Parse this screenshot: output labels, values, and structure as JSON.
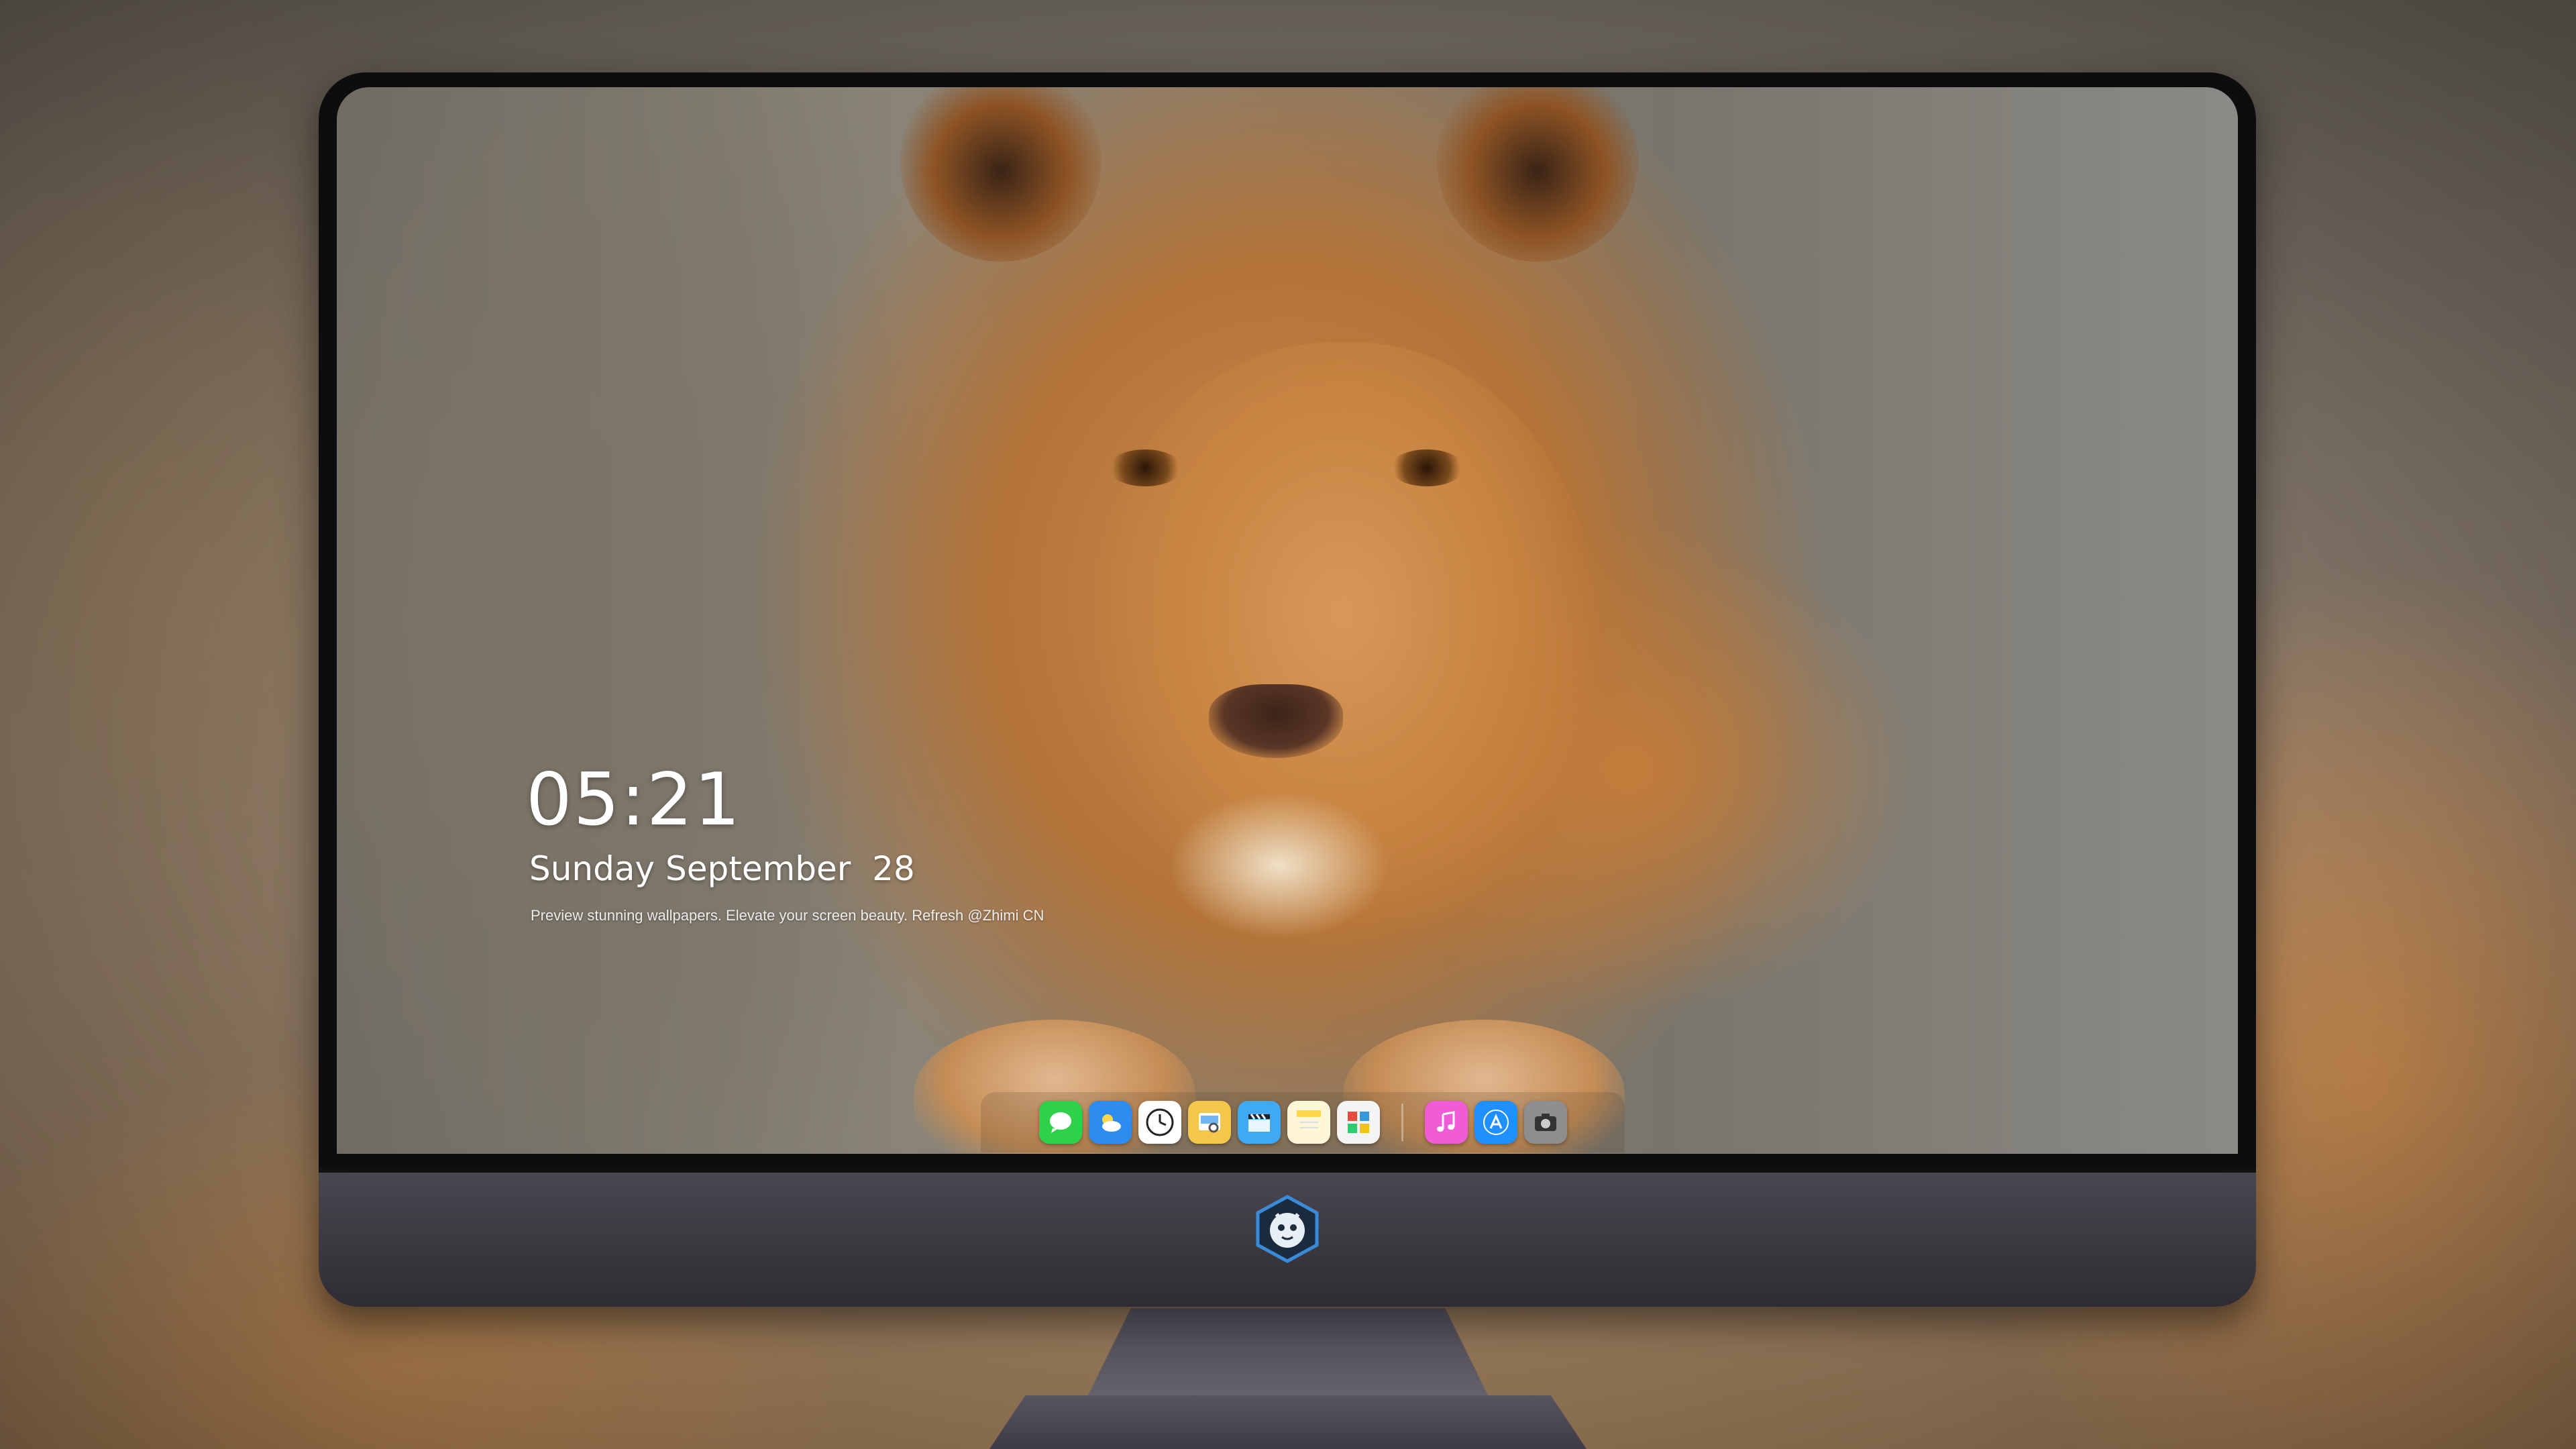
{
  "lock_screen": {
    "time": "05:21",
    "date": "Sunday September  28",
    "subtitle": "Preview stunning wallpapers. Elevate your screen beauty. Refresh @Zhimi CN"
  },
  "dock": {
    "apps": [
      {
        "icon": "messages-icon",
        "color": "#2fd14a"
      },
      {
        "icon": "weather-icon",
        "color": "#2d8cf0"
      },
      {
        "icon": "clock-icon",
        "color": "#ffffff"
      },
      {
        "icon": "preview-icon",
        "color": "#f3c74b"
      },
      {
        "icon": "clapperboard-icon",
        "color": "#3fa9f5"
      },
      {
        "icon": "notes-icon",
        "color": "#ffd54a"
      },
      {
        "icon": "photo-booth-icon",
        "color": "#e74c3c"
      },
      {
        "icon": "music-icon",
        "color": "#f05bd6"
      },
      {
        "icon": "app-store-icon",
        "color": "#1e90ff"
      },
      {
        "icon": "camera-icon",
        "color": "#9a9a9a"
      }
    ]
  },
  "monitor": {
    "chin_logo": "mascot-logo-icon"
  }
}
